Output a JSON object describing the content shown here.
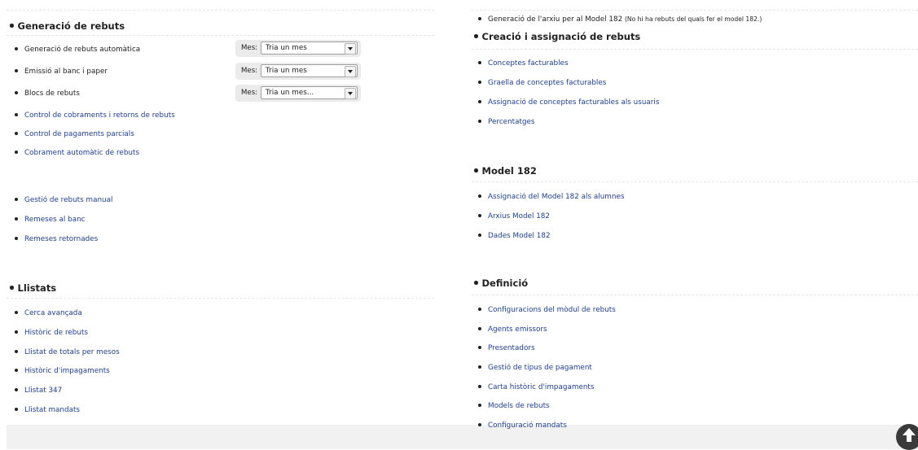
{
  "left": {
    "generacio": {
      "title": "Generació de rebuts",
      "items": [
        {
          "label": "Generació de rebuts automàtica"
        },
        {
          "label": "Emissió al banc i paper"
        },
        {
          "label": "Blocs de rebuts"
        },
        {
          "label": "Control de cobraments i retorns de rebuts"
        },
        {
          "label": "Control de pagaments parcials"
        },
        {
          "label": "Cobrament automàtic de rebuts"
        },
        {
          "label": "Gestió de rebuts manual"
        },
        {
          "label": "Remeses al banc"
        },
        {
          "label": "Remeses retornades"
        }
      ],
      "month_selects": [
        {
          "label": "Mes:",
          "value": "Tria un mes"
        },
        {
          "label": "Mes:",
          "value": "Tria un mes"
        },
        {
          "label": "Mes:",
          "value": "Tria un mes..."
        }
      ]
    },
    "llistats": {
      "title": "Llistats",
      "items": [
        {
          "label": "Cerca avançada"
        },
        {
          "label": "Històric de rebuts"
        },
        {
          "label": "Llistat de totals per mesos"
        },
        {
          "label": "Històric d'impagaments"
        },
        {
          "label": "Llistat 347"
        },
        {
          "label": "Llistat mandats"
        }
      ]
    }
  },
  "right": {
    "top_item": {
      "label": "Generació de l'arxiu per al Model 182",
      "note": "(No hi ha rebuts del quals fer el model 182.)"
    },
    "creacio": {
      "title": "Creació i assignació de rebuts",
      "items": [
        {
          "label": "Conceptes facturables"
        },
        {
          "label": "Graella de conceptes facturables"
        },
        {
          "label": "Assignació de conceptes facturables als usuaris"
        },
        {
          "label": "Percentatges"
        }
      ]
    },
    "model182": {
      "title": "Model 182",
      "items": [
        {
          "label": "Assignació del Model 182 als alumnes"
        },
        {
          "label": "Arxius Model 182"
        },
        {
          "label": "Dades Model 182"
        }
      ]
    },
    "definicio": {
      "title": "Definició",
      "items": [
        {
          "label": "Configuracions del mòdul de rebuts"
        },
        {
          "label": "Agents emissors"
        },
        {
          "label": "Presentadors"
        },
        {
          "label": "Gestió de tipus de pagament"
        },
        {
          "label": "Carta històric d'impagaments"
        },
        {
          "label": "Models de rebuts"
        },
        {
          "label": "Configuració mandats"
        }
      ]
    }
  },
  "icons": {
    "scroll_top": "arrow-up-circle-icon"
  },
  "colors": {
    "link": "#1f3f8a",
    "text": "#222222",
    "footer": "#f1f1f1",
    "select_panel": "#ebebeb"
  }
}
